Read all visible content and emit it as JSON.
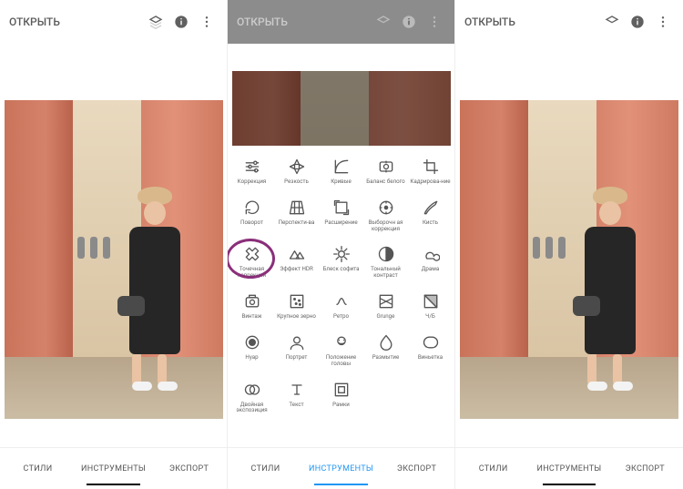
{
  "topbar": {
    "open_label": "ОТКРЫТЬ",
    "icons": {
      "layers": "layers",
      "info": "info",
      "more": "more"
    }
  },
  "bottom_tabs": {
    "styles": "СТИЛИ",
    "tools": "ИНСТРУМЕНТЫ",
    "export": "ЭКСПОРТ"
  },
  "panels": {
    "left": {
      "active_tab": "tools"
    },
    "middle": {
      "active_tab": "tools"
    },
    "right": {
      "active_tab": "tools"
    }
  },
  "highlighted_tool_index": 10,
  "tools": [
    {
      "id": "tune",
      "label": "Коррекция"
    },
    {
      "id": "details",
      "label": "Резкость"
    },
    {
      "id": "curves",
      "label": "Кривые"
    },
    {
      "id": "white-balance",
      "label": "Баланс белого"
    },
    {
      "id": "crop",
      "label": "Кадрирова-ние"
    },
    {
      "id": "rotate",
      "label": "Поворот"
    },
    {
      "id": "perspective",
      "label": "Перспекти-ва"
    },
    {
      "id": "expand",
      "label": "Расширение"
    },
    {
      "id": "selective",
      "label": "Выборочн ая коррекция"
    },
    {
      "id": "brush",
      "label": "Кисть"
    },
    {
      "id": "healing",
      "label": "Точечная коррекция"
    },
    {
      "id": "hdr",
      "label": "Эффект HDR"
    },
    {
      "id": "glamour",
      "label": "Блеск софита"
    },
    {
      "id": "tonal",
      "label": "Тональный контраст"
    },
    {
      "id": "drama",
      "label": "Драма"
    },
    {
      "id": "vintage",
      "label": "Винтаж"
    },
    {
      "id": "grainy",
      "label": "Крупное зерно"
    },
    {
      "id": "retrolux",
      "label": "Ретро"
    },
    {
      "id": "grunge",
      "label": "Grunge"
    },
    {
      "id": "bw",
      "label": "Ч/Б"
    },
    {
      "id": "noir",
      "label": "Нуар"
    },
    {
      "id": "portrait",
      "label": "Портрет"
    },
    {
      "id": "headpose",
      "label": "Положение головы"
    },
    {
      "id": "blur",
      "label": "Размытие"
    },
    {
      "id": "vignette",
      "label": "Виньетка"
    },
    {
      "id": "double-exp",
      "label": "Двойная экспозиция"
    },
    {
      "id": "text",
      "label": "Текст"
    },
    {
      "id": "frames",
      "label": "Рамки"
    }
  ]
}
